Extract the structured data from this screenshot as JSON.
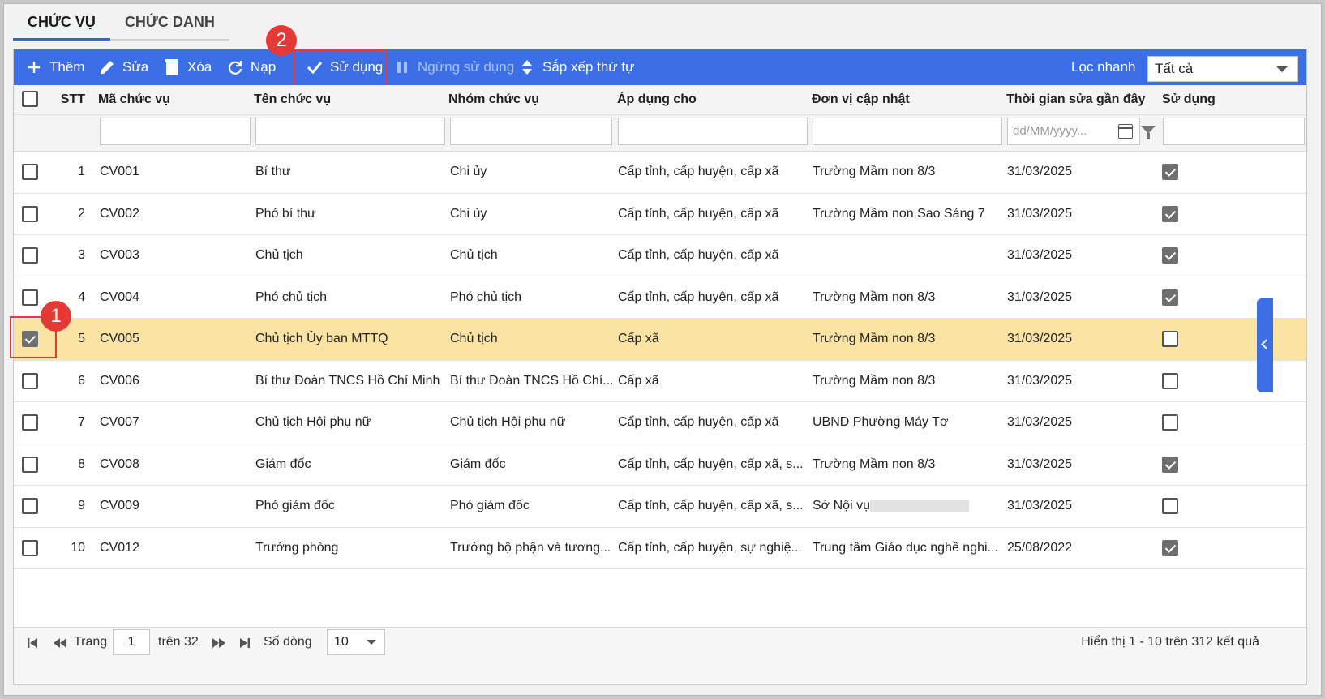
{
  "tabs": [
    {
      "label": "CHỨC VỤ",
      "active": true
    },
    {
      "label": "CHỨC DANH",
      "active": false
    }
  ],
  "toolbar": {
    "add": "Thêm",
    "edit": "Sửa",
    "delete": "Xóa",
    "reload": "Nạp",
    "use": "Sử dụng",
    "stop_use": "Ngừng sử dụng",
    "sort": "Sắp xếp thứ tự",
    "quick_filter_label": "Lọc nhanh",
    "quick_filter_value": "Tất cả"
  },
  "columns": {
    "stt": "STT",
    "code": "Mã chức vụ",
    "name": "Tên chức vụ",
    "group": "Nhóm chức vụ",
    "apply": "Áp dụng cho",
    "unit": "Đơn vị cập nhật",
    "time": "Thời gian sửa gần đây",
    "use": "Sử dụng"
  },
  "filters": {
    "date_placeholder": "dd/MM/yyyy..."
  },
  "rows": [
    {
      "stt": "1",
      "code": "CV001",
      "name": "Bí thư",
      "group": "Chi ủy",
      "apply": "Cấp tỉnh, cấp huyện, cấp xã",
      "unit": "Trường Mầm non 8/3",
      "time": "31/03/2025",
      "use": true,
      "selected": false
    },
    {
      "stt": "2",
      "code": "CV002",
      "name": "Phó bí thư",
      "group": "Chi ủy",
      "apply": "Cấp tỉnh, cấp huyện, cấp xã",
      "unit": "Trường Mầm non Sao Sáng 7",
      "time": "31/03/2025",
      "use": true,
      "selected": false
    },
    {
      "stt": "3",
      "code": "CV003",
      "name": "Chủ tịch",
      "group": "Chủ tịch",
      "apply": "Cấp tỉnh, cấp huyện, cấp xã",
      "unit": "",
      "time": "31/03/2025",
      "use": true,
      "selected": false
    },
    {
      "stt": "4",
      "code": "CV004",
      "name": "Phó chủ tịch",
      "group": "Phó chủ tịch",
      "apply": "Cấp tỉnh, cấp huyện, cấp xã",
      "unit": "Trường Mầm non 8/3",
      "time": "31/03/2025",
      "use": true,
      "selected": false
    },
    {
      "stt": "5",
      "code": "CV005",
      "name": "Chủ tịch Ủy ban MTTQ",
      "group": "Chủ tịch",
      "apply": "Cấp xã",
      "unit": "Trường Mầm non 8/3",
      "time": "31/03/2025",
      "use": false,
      "selected": true
    },
    {
      "stt": "6",
      "code": "CV006",
      "name": "Bí thư Đoàn TNCS Hồ Chí Minh",
      "group": "Bí thư Đoàn TNCS Hồ Chí...",
      "apply": "Cấp xã",
      "unit": "Trường Mầm non 8/3",
      "time": "31/03/2025",
      "use": false,
      "selected": false
    },
    {
      "stt": "7",
      "code": "CV007",
      "name": "Chủ tịch Hội phụ nữ",
      "group": "Chủ tịch Hội phụ nữ",
      "apply": "Cấp tỉnh, cấp huyện, cấp xã",
      "unit": "UBND Phường Máy Tơ",
      "time": "31/03/2025",
      "use": false,
      "selected": false
    },
    {
      "stt": "8",
      "code": "CV008",
      "name": "Giám đốc",
      "group": "Giám đốc",
      "apply": "Cấp tỉnh, cấp huyện, cấp xã, s...",
      "unit": "Trường Mầm non 8/3",
      "time": "31/03/2025",
      "use": true,
      "selected": false
    },
    {
      "stt": "9",
      "code": "CV009",
      "name": "Phó giám đốc",
      "group": "Phó giám đốc",
      "apply": "Cấp tỉnh, cấp huyện, cấp xã, s...",
      "unit": "Sở Nội vụ",
      "time": "31/03/2025",
      "use": false,
      "selected": false,
      "unit_redacted": true
    },
    {
      "stt": "10",
      "code": "CV012",
      "name": "Trưởng phòng",
      "group": "Trưởng bộ phận và tương...",
      "apply": "Cấp tỉnh, cấp huyện, sự nghiệ...",
      "unit": "Trung tâm Giáo dục nghề nghi...",
      "time": "25/08/2022",
      "use": true,
      "selected": false
    }
  ],
  "footer": {
    "page_label": "Trang",
    "page_value": "1",
    "of_label": "trên 32",
    "rows_label": "Số dòng",
    "rows_value": "10",
    "summary": "Hiển thị 1 - 10 trên 312 kết quả"
  },
  "markers": {
    "m1": "1",
    "m2": "2"
  },
  "colors": {
    "accent": "#3c6ee6",
    "selected_row": "#fbe3a4",
    "callout": "#e53935"
  }
}
